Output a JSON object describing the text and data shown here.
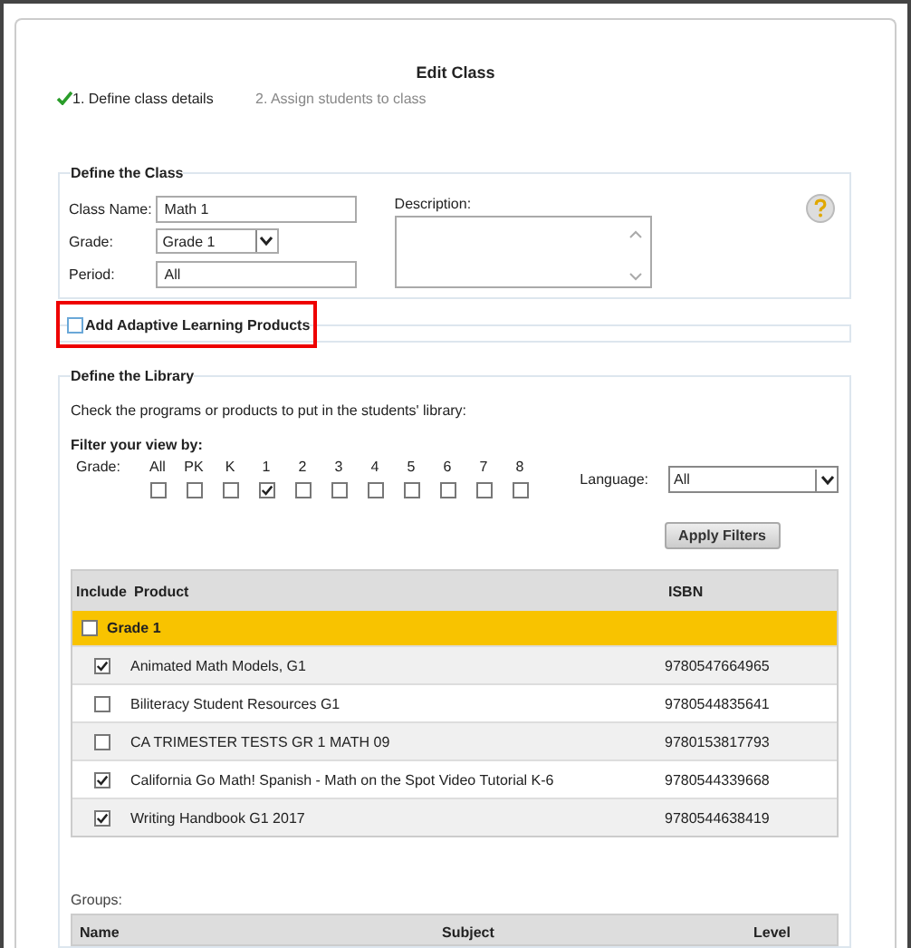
{
  "title": "Edit Class",
  "steps": [
    {
      "label": "1. Define class details",
      "completed": true
    },
    {
      "label": "2. Assign students to class",
      "completed": false
    }
  ],
  "define_class": {
    "legend": "Define the Class",
    "fields": [
      {
        "kind": "text",
        "label": "Class Name:",
        "value": "Math 1"
      },
      {
        "kind": "select",
        "label": "Grade:",
        "value": "Grade 1"
      },
      {
        "kind": "text",
        "label": "Period:",
        "value": "All"
      }
    ],
    "description_label": "Description:"
  },
  "adaptive": {
    "label": "Add Adaptive Learning Products",
    "checked": false,
    "highlighted": true
  },
  "library": {
    "legend": "Define the Library",
    "instruction": "Check the programs or products to put in the students' library:",
    "filter_title": "Filter your view by:",
    "grade_label": "Grade:",
    "grades": [
      {
        "label": "All",
        "checked": false
      },
      {
        "label": "PK",
        "checked": false
      },
      {
        "label": "K",
        "checked": false
      },
      {
        "label": "1",
        "checked": true
      },
      {
        "label": "2",
        "checked": false
      },
      {
        "label": "3",
        "checked": false
      },
      {
        "label": "4",
        "checked": false
      },
      {
        "label": "5",
        "checked": false
      },
      {
        "label": "6",
        "checked": false
      },
      {
        "label": "7",
        "checked": false
      },
      {
        "label": "8",
        "checked": false
      }
    ],
    "language_label": "Language:",
    "language_value": "All",
    "apply_button": "Apply Filters",
    "table": {
      "columns": [
        "Include",
        "Product",
        "ISBN"
      ],
      "group": {
        "label": "Grade 1",
        "checked": false
      },
      "rows": [
        {
          "product": "Animated Math Models, G1",
          "isbn": "9780547664965",
          "checked": true
        },
        {
          "product": "Biliteracy Student Resources G1",
          "isbn": "9780544835641",
          "checked": false
        },
        {
          "product": "CA TRIMESTER TESTS GR 1 MATH 09",
          "isbn": "9780153817793",
          "checked": false
        },
        {
          "product": "California Go Math! Spanish - Math on the Spot Video Tutorial K-6",
          "isbn": "9780544339668",
          "checked": true
        },
        {
          "product": "Writing Handbook G1 2017",
          "isbn": "9780544638419",
          "checked": true
        }
      ]
    },
    "groups_label": "Groups:",
    "groups_columns": [
      "Name",
      "Subject",
      "Level"
    ]
  }
}
